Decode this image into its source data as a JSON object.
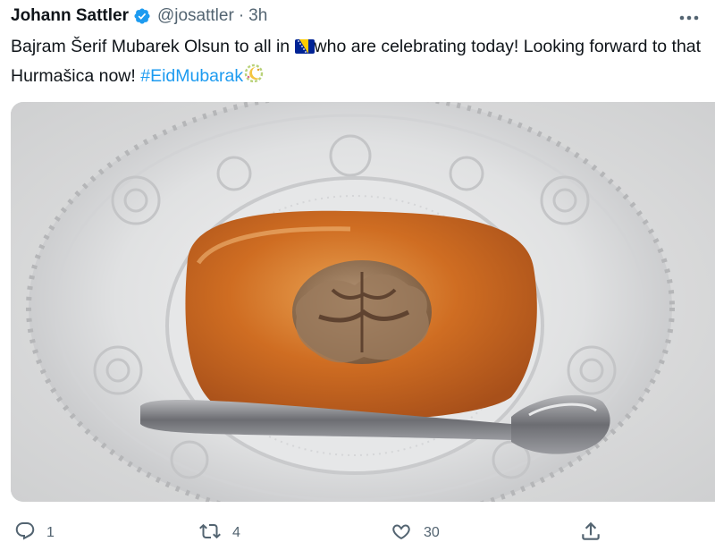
{
  "tweet": {
    "author_name": "Johann Sattler",
    "handle": "@josattler",
    "separator": "·",
    "time": "3h",
    "text_part1": "Bajram Šerif Mubarek Olsun to all in ",
    "text_part2": "who are celebrating today! Looking forward to that Hurmašica now! ",
    "hashtag": "#EidMubarak"
  },
  "actions": {
    "replies": "1",
    "retweets": "4",
    "likes": "30"
  },
  "icons": {
    "verified": "verified-badge-icon",
    "more": "more-options-icon",
    "flag": "bosnia-flag-icon",
    "eid_emoji": "crescent-moon-emoji-icon",
    "reply": "reply-icon",
    "retweet": "retweet-icon",
    "like": "heart-icon",
    "share": "share-icon"
  },
  "colors": {
    "accent": "#1d9bf0",
    "secondary_text": "#536471",
    "primary_text": "#0f1419"
  }
}
